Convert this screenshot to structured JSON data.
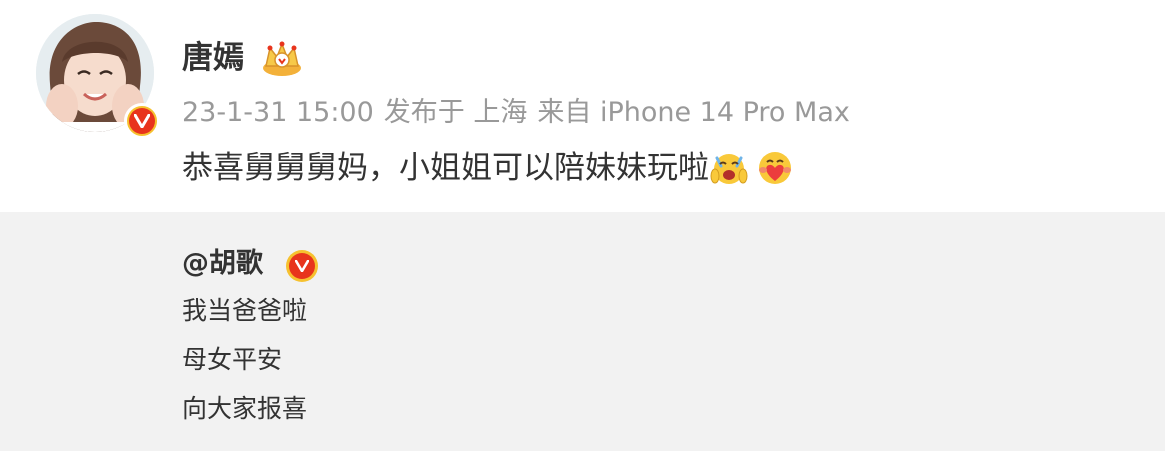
{
  "post": {
    "author": "唐嫣",
    "date": "23-1-31 15:00",
    "published_at": "发布于 上海",
    "source": "来自 iPhone 14 Pro Max",
    "text": "恭喜舅舅舅妈，小姐姐可以陪妹妹玩啦"
  },
  "repost": {
    "author": "@胡歌",
    "lines": [
      "我当爸爸啦",
      "母女平安",
      "向大家报喜"
    ]
  },
  "icons": {
    "verified": "verified-v-badge",
    "member_crown": "crown-icon",
    "emoji_1": "excited-scream-emoji",
    "emoji_2": "heart-hug-emoji"
  },
  "colors": {
    "name_text": "#333333",
    "meta_text": "#999999",
    "repost_bg": "#f2f2f2",
    "badge_red": "#e8341c",
    "badge_gold": "#f6c12f"
  }
}
